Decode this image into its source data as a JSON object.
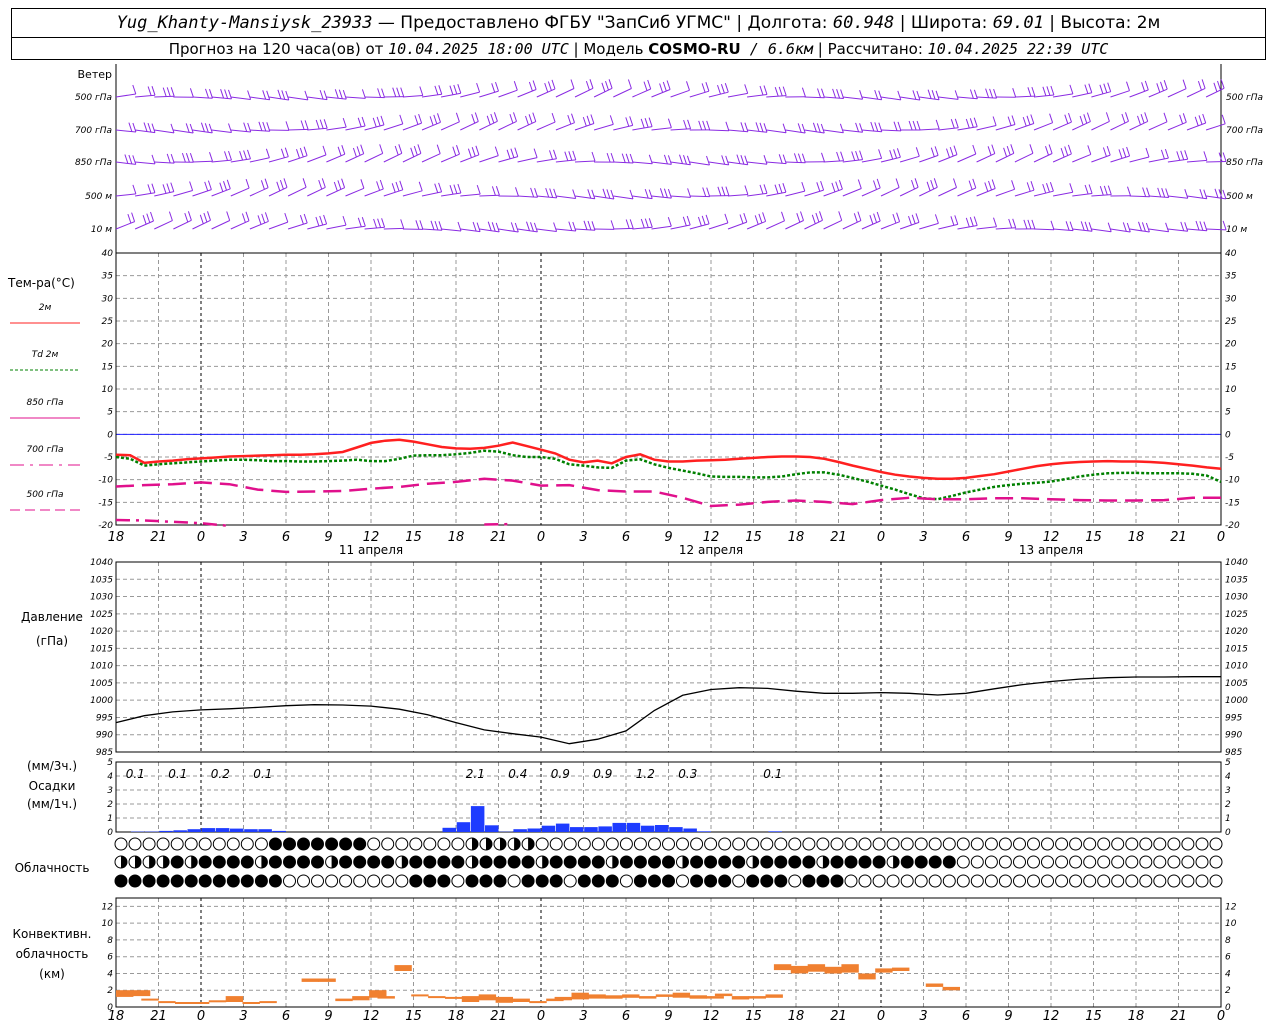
{
  "header": {
    "station": "Yug_Khanty-Mansiysk_23933",
    "provider": " — Предоставлено ФГБУ \"ЗапСиб УГМС\" | Долгота: ",
    "lon": "60.948",
    "lat_label": " | Широта: ",
    "lat": "69.01",
    "alt_label": " | Высота: ",
    "alt": "2м",
    "forecast_label": "Прогноз на 120 часа(ов) от ",
    "forecast_time": "10.04.2025 18:00 UTC",
    "model_label": "  | Модель ",
    "model": "COSMO-RU",
    "resolution": " / 6.6км",
    "calc_label": " | Рассчитано: ",
    "calc_time": "10.04.2025 22:39 UTC"
  },
  "colors": {
    "t2m": "#ff2020",
    "td2m": "#008000",
    "t850": "#e0108c",
    "t700": "#e0108c",
    "t500": "#e0108c",
    "wind": "#8a2be2",
    "precip": "#1e3cff",
    "conv": "#f08030",
    "grid": "#999999",
    "zero": "#2020ff"
  },
  "wind_panel": {
    "title": "Ветер",
    "levels": [
      "500 гПа",
      "700 гПа",
      "850 гПа",
      "500 м",
      "10 м"
    ],
    "right_levels": [
      "500 гПа",
      "700 гПа",
      "850 гПа",
      "500 м",
      "10 м"
    ]
  },
  "temp_panel": {
    "title": "Тем-ра(°C)",
    "legend": [
      {
        "label": "2м",
        "style": "solid"
      },
      {
        "label": "Td 2м",
        "style": "dotted"
      },
      {
        "label": "850 гПа",
        "style": "solid"
      },
      {
        "label": "700 гПа",
        "style": "dashdot"
      },
      {
        "label": "500 гПа",
        "style": "dashed"
      }
    ],
    "y_ticks": [
      "40",
      "35",
      "30",
      "25",
      "20",
      "15",
      "10",
      "5",
      "0",
      "-5",
      "-10",
      "-15",
      "-20"
    ],
    "x_ticks": [
      "18",
      "21",
      "0",
      "3",
      "6",
      "9",
      "12",
      "15",
      "18",
      "21",
      "0",
      "3",
      "6",
      "9",
      "12",
      "15",
      "18",
      "21",
      "0",
      "3",
      "6",
      "9",
      "12",
      "15",
      "18",
      "21",
      "0"
    ],
    "days": [
      "11 апреля",
      "12 апреля",
      "13 апреля"
    ]
  },
  "pressure_panel": {
    "title": "Давление",
    "unit": "(гПа)",
    "y_ticks": [
      "1040",
      "1035",
      "1030",
      "1025",
      "1020",
      "1015",
      "1010",
      "1005",
      "1000",
      "995",
      "990",
      "985"
    ]
  },
  "precip_panel": {
    "unit3": "(мм/3ч.)",
    "title": "Осадки",
    "unit1": "(мм/1ч.)",
    "y_ticks": [
      "5",
      "4",
      "3",
      "2",
      "1",
      "0"
    ],
    "labels": [
      {
        "h": 2,
        "text": "0.1"
      },
      {
        "h": 5,
        "text": "0.1"
      },
      {
        "h": 8,
        "text": "0.2"
      },
      {
        "h": 11,
        "text": "0.1"
      },
      {
        "h": 26,
        "text": "2.1"
      },
      {
        "h": 29,
        "text": "0.4"
      },
      {
        "h": 32,
        "text": "0.9"
      },
      {
        "h": 35,
        "text": "0.9"
      },
      {
        "h": 38,
        "text": "1.2"
      },
      {
        "h": 41,
        "text": "0.3"
      },
      {
        "h": 47,
        "text": "0.1"
      }
    ]
  },
  "cloud_panel": {
    "title": "Облачность"
  },
  "conv_panel": {
    "title1": "Конвективн.",
    "title2": "облачность",
    "unit": "(км)",
    "y_ticks": [
      "12",
      "10",
      "8",
      "6",
      "4",
      "2",
      "0"
    ]
  },
  "chart_data": {
    "type": "line",
    "x_unit": "hours since 10.04.2025 18:00 UTC",
    "x_range": [
      0,
      78
    ],
    "temperature": {
      "ylim": [
        -20,
        40
      ],
      "series": [
        {
          "name": "2м",
          "x": [
            0,
            1,
            2,
            3,
            4,
            5,
            6,
            7,
            8,
            9,
            10,
            11,
            12,
            13,
            14,
            15,
            16,
            17,
            18,
            19,
            20,
            21,
            22,
            23,
            24,
            25,
            26,
            27,
            28,
            29,
            30,
            31,
            32,
            33,
            34,
            35,
            36,
            37,
            38,
            39,
            40,
            41,
            42,
            43,
            44,
            45,
            46,
            47,
            48,
            49,
            50,
            51,
            52,
            53,
            54,
            55,
            56,
            57,
            58,
            59,
            60,
            61,
            62,
            63,
            64,
            65,
            66,
            67,
            68,
            69,
            70,
            71,
            72,
            73,
            74,
            75,
            76,
            77,
            78
          ],
          "values": [
            -4.5,
            -4.6,
            -6.3,
            -6.0,
            -5.8,
            -5.5,
            -5.3,
            -5.1,
            -4.9,
            -4.8,
            -4.7,
            -4.6,
            -4.5,
            -4.5,
            -4.4,
            -4.2,
            -3.9,
            -2.9,
            -1.9,
            -1.4,
            -1.2,
            -1.6,
            -2.2,
            -2.8,
            -3.1,
            -3.2,
            -3.0,
            -2.5,
            -1.8,
            -2.6,
            -3.4,
            -4.2,
            -5.6,
            -6.2,
            -5.8,
            -6.4,
            -5.0,
            -4.4,
            -5.6,
            -6.0,
            -6.0,
            -5.8,
            -5.7,
            -5.6,
            -5.4,
            -5.2,
            -5.0,
            -4.9,
            -4.9,
            -5.0,
            -5.4,
            -6.1,
            -6.9,
            -7.6,
            -8.3,
            -8.9,
            -9.3,
            -9.6,
            -9.8,
            -9.8,
            -9.6,
            -9.2,
            -8.8,
            -8.2,
            -7.6,
            -7.0,
            -6.6,
            -6.3,
            -6.1,
            -6.0,
            -5.9,
            -6.0,
            -6.0,
            -6.1,
            -6.3,
            -6.6,
            -6.9,
            -7.3,
            -7.6
          ]
        },
        {
          "name": "Td 2м",
          "x": [
            0,
            1,
            2,
            3,
            4,
            5,
            6,
            7,
            8,
            9,
            10,
            11,
            12,
            13,
            14,
            15,
            16,
            17,
            18,
            19,
            20,
            21,
            22,
            23,
            24,
            25,
            26,
            27,
            28,
            29,
            30,
            31,
            32,
            33,
            34,
            35,
            36,
            37,
            38,
            39,
            40,
            41,
            42,
            43,
            44,
            45,
            46,
            47,
            48,
            49,
            50,
            51,
            52,
            53,
            54,
            55,
            56,
            57,
            58,
            59,
            60,
            61,
            62,
            63,
            64,
            65,
            66,
            67,
            68,
            69,
            70,
            71,
            72,
            73,
            74,
            75,
            76,
            77,
            78
          ],
          "values": [
            -5.0,
            -5.4,
            -6.9,
            -6.6,
            -6.4,
            -6.2,
            -6.0,
            -5.8,
            -5.6,
            -5.6,
            -5.7,
            -5.9,
            -5.9,
            -6.0,
            -6.0,
            -5.9,
            -5.8,
            -5.6,
            -5.9,
            -5.9,
            -5.4,
            -4.7,
            -4.6,
            -4.6,
            -4.4,
            -4.1,
            -3.6,
            -3.8,
            -4.6,
            -5.0,
            -5.0,
            -5.4,
            -6.6,
            -6.9,
            -7.3,
            -7.4,
            -5.8,
            -5.5,
            -6.6,
            -7.4,
            -8.0,
            -8.6,
            -9.3,
            -9.4,
            -9.4,
            -9.5,
            -9.5,
            -9.3,
            -8.8,
            -8.4,
            -8.4,
            -8.9,
            -9.6,
            -10.4,
            -11.3,
            -12.2,
            -13.2,
            -14.1,
            -14.3,
            -13.6,
            -12.8,
            -12.2,
            -11.6,
            -11.2,
            -10.9,
            -10.7,
            -10.4,
            -9.9,
            -9.3,
            -8.9,
            -8.6,
            -8.5,
            -8.5,
            -8.6,
            -8.6,
            -8.6,
            -8.7,
            -9.1,
            -10.5
          ]
        },
        {
          "name": "850 гПа",
          "x": [
            0,
            2,
            4,
            6,
            8,
            10,
            12,
            14,
            16,
            18,
            20,
            22,
            24,
            26,
            28,
            30,
            32,
            34,
            36,
            38,
            40,
            42,
            44,
            46,
            48,
            50,
            52,
            54,
            56,
            58,
            60,
            62,
            64,
            66,
            68,
            70,
            72,
            74,
            76,
            78
          ],
          "values": [
            -11.5,
            -11.2,
            -11.0,
            -10.6,
            -11.0,
            -12.2,
            -12.7,
            -12.6,
            -12.5,
            -12.0,
            -11.6,
            -10.9,
            -10.5,
            -9.8,
            -10.2,
            -11.3,
            -11.2,
            -12.3,
            -12.6,
            -12.6,
            -14.0,
            -15.8,
            -15.5,
            -14.9,
            -14.6,
            -14.9,
            -15.4,
            -14.5,
            -14.0,
            -14.3,
            -14.3,
            -14.1,
            -14.1,
            -14.3,
            -14.5,
            -14.6,
            -14.6,
            -14.5,
            -14.0,
            -14.0
          ]
        },
        {
          "name": "700 гПа",
          "x": [
            0,
            2,
            4,
            6,
            8,
            10,
            12,
            14,
            16,
            18,
            20,
            22,
            24,
            26,
            28
          ],
          "values": [
            -18.9,
            -19.0,
            -19.3,
            -19.6,
            -20.2,
            null,
            null,
            null,
            null,
            null,
            null,
            null,
            null,
            -19.9,
            -19.8
          ]
        }
      ]
    },
    "pressure": {
      "ylim": [
        985,
        1040
      ],
      "x": [
        0,
        2,
        4,
        6,
        8,
        10,
        12,
        14,
        16,
        18,
        20,
        22,
        24,
        26,
        28,
        30,
        32,
        34,
        36,
        38,
        40,
        42,
        44,
        46,
        48,
        50,
        52,
        54,
        56,
        58,
        60,
        62,
        64,
        66,
        68,
        70,
        72,
        74,
        76,
        78
      ],
      "values": [
        993.5,
        995.5,
        996.6,
        997.2,
        997.5,
        997.9,
        998.4,
        998.7,
        998.6,
        998.3,
        997.4,
        995.8,
        993.5,
        991.4,
        990.3,
        989.3,
        987.4,
        988.7,
        991.1,
        997.0,
        1001.4,
        1003.1,
        1003.6,
        1003.4,
        1002.6,
        1002.0,
        1002.0,
        1002.2,
        1002.0,
        1001.5,
        1002.0,
        1003.3,
        1004.5,
        1005.4,
        1006.1,
        1006.5,
        1006.7,
        1006.7,
        1006.8,
        1006.8
      ]
    },
    "precip_1h": {
      "ylim": [
        0,
        5
      ],
      "x": [
        2,
        3,
        4,
        5,
        6,
        7,
        8,
        9,
        10,
        11,
        12,
        24,
        25,
        26,
        27,
        28,
        29,
        30,
        31,
        32,
        33,
        34,
        35,
        36,
        37,
        38,
        39,
        40,
        41,
        42,
        47
      ],
      "values": [
        0.03,
        0.03,
        0.08,
        0.12,
        0.2,
        0.28,
        0.28,
        0.24,
        0.2,
        0.2,
        0.08,
        0.3,
        0.7,
        1.85,
        0.48,
        0.02,
        0.2,
        0.25,
        0.45,
        0.6,
        0.35,
        0.35,
        0.4,
        0.65,
        0.65,
        0.45,
        0.5,
        0.35,
        0.25,
        0.05,
        0.05
      ]
    },
    "convective_cloud_km": {
      "ylim": [
        0,
        13
      ],
      "bars": [
        [
          0,
          1.2,
          2.0
        ],
        [
          2,
          1.3,
          2.0
        ],
        [
          3,
          0.8,
          1.0
        ],
        [
          5,
          0.5,
          0.7
        ],
        [
          7,
          0.4,
          0.6
        ],
        [
          9,
          0.5,
          0.6
        ],
        [
          11,
          0.6,
          0.8
        ],
        [
          13,
          0.6,
          1.3
        ],
        [
          15,
          0.5,
          0.6
        ],
        [
          17,
          0.5,
          0.7
        ],
        [
          22,
          3.0,
          3.4
        ],
        [
          24,
          3.0,
          3.4
        ],
        [
          26,
          0.7,
          1.0
        ],
        [
          28,
          0.8,
          1.3
        ],
        [
          30,
          1.1,
          2.0
        ],
        [
          31,
          1.0,
          1.3
        ],
        [
          33,
          4.3,
          5.0
        ],
        [
          35,
          1.3,
          1.5
        ],
        [
          37,
          1.2,
          1.3
        ],
        [
          39,
          1.0,
          1.2
        ],
        [
          41,
          0.6,
          1.3
        ],
        [
          43,
          0.8,
          1.5
        ],
        [
          45,
          0.5,
          1.2
        ],
        [
          47,
          0.6,
          1.0
        ],
        [
          49,
          0.6,
          0.7
        ],
        [
          51,
          0.7,
          1.0
        ],
        [
          52,
          0.8,
          1.2
        ],
        [
          54,
          0.9,
          1.7
        ],
        [
          56,
          1.0,
          1.5
        ],
        [
          58,
          1.0,
          1.4
        ],
        [
          60,
          1.1,
          1.5
        ],
        [
          62,
          1.0,
          1.3
        ],
        [
          64,
          1.2,
          1.5
        ],
        [
          66,
          1.1,
          1.7
        ],
        [
          68,
          1.0,
          1.4
        ],
        [
          70,
          1.0,
          1.3
        ],
        [
          71,
          1.3,
          1.6
        ],
        [
          73,
          0.9,
          1.3
        ],
        [
          75,
          1.0,
          1.3
        ],
        [
          77,
          1.1,
          1.5
        ],
        [
          78,
          4.4,
          5.1
        ],
        [
          80,
          4.0,
          4.9
        ],
        [
          82,
          4.2,
          5.1
        ],
        [
          84,
          4.0,
          4.8
        ],
        [
          86,
          4.1,
          5.1
        ],
        [
          88,
          3.3,
          4.0
        ],
        [
          90,
          4.1,
          4.6
        ],
        [
          92,
          4.3,
          4.7
        ],
        [
          96,
          2.4,
          2.8
        ],
        [
          98,
          2.0,
          2.4
        ]
      ]
    },
    "cloud_cover": {
      "rows": [
        "upper",
        "middle",
        "lower"
      ]
    }
  }
}
